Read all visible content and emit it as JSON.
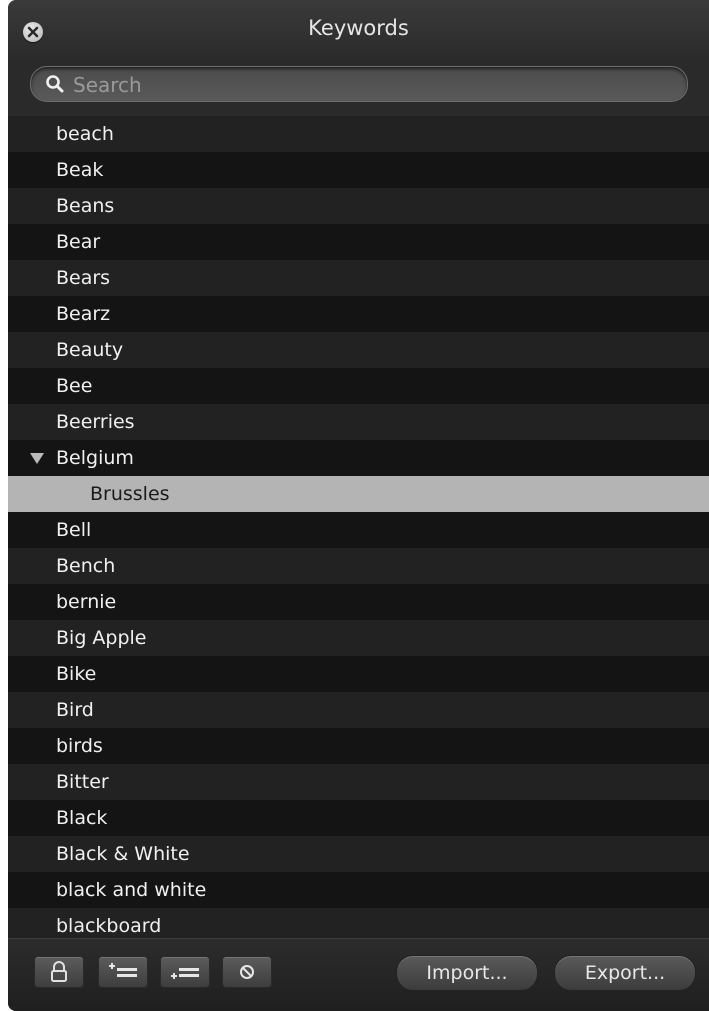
{
  "window": {
    "title": "Keywords"
  },
  "search": {
    "placeholder": "Search",
    "value": ""
  },
  "keywords": [
    {
      "label": "beach"
    },
    {
      "label": "Beak"
    },
    {
      "label": "Beans"
    },
    {
      "label": "Bear"
    },
    {
      "label": "Bears"
    },
    {
      "label": "Bearz"
    },
    {
      "label": "Beauty"
    },
    {
      "label": "Bee"
    },
    {
      "label": "Beerries"
    },
    {
      "label": "Belgium",
      "expanded": true
    },
    {
      "label": "Brussles",
      "child": true,
      "selected": true
    },
    {
      "label": "Bell"
    },
    {
      "label": "Bench"
    },
    {
      "label": "bernie"
    },
    {
      "label": "Big Apple"
    },
    {
      "label": "Bike"
    },
    {
      "label": "Bird"
    },
    {
      "label": "birds"
    },
    {
      "label": "Bitter"
    },
    {
      "label": "Black"
    },
    {
      "label": "Black & White"
    },
    {
      "label": "black and white"
    },
    {
      "label": "blackboard"
    }
  ],
  "footer": {
    "icons": [
      "lock-icon",
      "add-keyword-icon",
      "add-subkeyword-icon",
      "remove-keyword-icon"
    ],
    "import_label": "Import...",
    "export_label": "Export..."
  },
  "colors": {
    "selected_row": "#b4b4b4",
    "panel": "#1e1e1e"
  }
}
